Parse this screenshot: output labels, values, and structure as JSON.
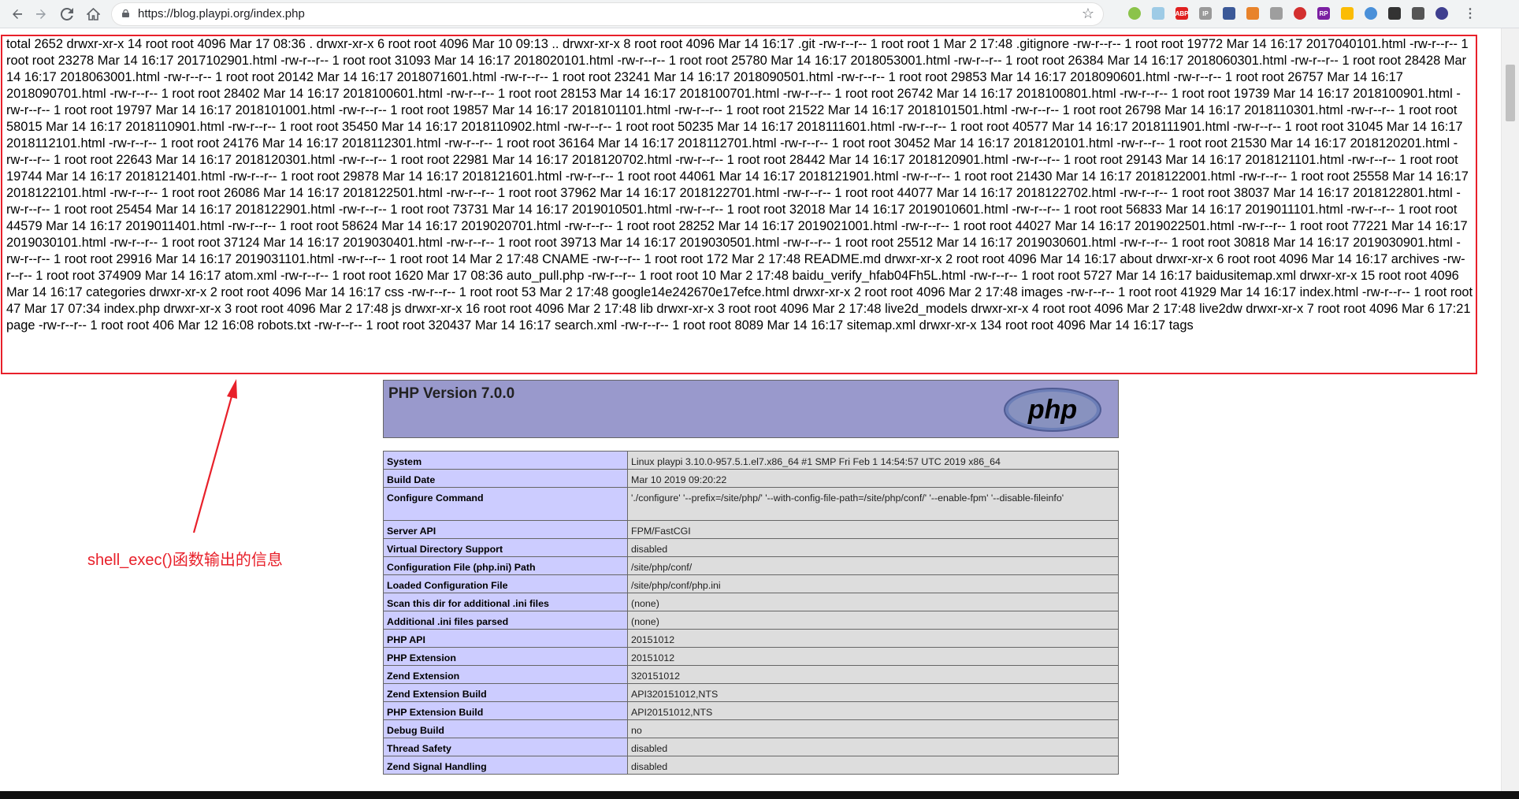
{
  "browser": {
    "url": "https://blog.playpi.org/index.php",
    "icons": [
      "back-icon",
      "forward-icon",
      "reload-icon",
      "home-icon",
      "lock-icon",
      "bookmark-star-icon"
    ],
    "extensions": [
      {
        "name": "green-dot-extension-icon",
        "color": "#8bc34a",
        "label": ""
      },
      {
        "name": "cloud-extension-icon",
        "color": "#9ecbe6",
        "label": ""
      },
      {
        "name": "adblock-plus-extension-icon",
        "color": "#e02020",
        "label": "ABP"
      },
      {
        "name": "ip-extension-icon",
        "color": "#999999",
        "label": "IP"
      },
      {
        "name": "square-extension-icon",
        "color": "#3b5998",
        "label": ""
      },
      {
        "name": "fox-extension-icon",
        "color": "#e8832b",
        "label": ""
      },
      {
        "name": "parachute-extension-icon",
        "color": "#9e9e9e",
        "label": ""
      },
      {
        "name": "red-circle-extension-icon",
        "color": "#d32f2f",
        "label": ""
      },
      {
        "name": "rp-extension-icon",
        "color": "#7b1fa2",
        "label": "RP"
      },
      {
        "name": "chrome-extension-icon",
        "color": "#fbbc05",
        "label": ""
      },
      {
        "name": "blue-circle-extension-icon",
        "color": "#4a90d9",
        "label": ""
      },
      {
        "name": "dark-square-extension-icon",
        "color": "#333333",
        "label": ""
      },
      {
        "name": "gear-extension-icon",
        "color": "#555555",
        "label": ""
      },
      {
        "name": "purple-dot-extension-icon",
        "color": "#3f3f8f",
        "label": ""
      },
      {
        "name": "menu-icon",
        "color": "#5f6368",
        "label": ""
      }
    ]
  },
  "shell_output": "total 2652 drwxr-xr-x 14 root root 4096 Mar 17 08:36 . drwxr-xr-x 6 root root 4096 Mar 10 09:13 .. drwxr-xr-x 8 root root 4096 Mar 14 16:17 .git -rw-r--r-- 1 root root 1 Mar 2 17:48 .gitignore -rw-r--r-- 1 root root 19772 Mar 14 16:17 2017040101.html -rw-r--r-- 1 root root 23278 Mar 14 16:17 2017102901.html -rw-r--r-- 1 root root 31093 Mar 14 16:17 2018020101.html -rw-r--r-- 1 root root 25780 Mar 14 16:17 2018053001.html -rw-r--r-- 1 root root 26384 Mar 14 16:17 2018060301.html -rw-r--r-- 1 root root 28428 Mar 14 16:17 2018063001.html -rw-r--r-- 1 root root 20142 Mar 14 16:17 2018071601.html -rw-r--r-- 1 root root 23241 Mar 14 16:17 2018090501.html -rw-r--r-- 1 root root 29853 Mar 14 16:17 2018090601.html -rw-r--r-- 1 root root 26757 Mar 14 16:17 2018090701.html -rw-r--r-- 1 root root 28402 Mar 14 16:17 2018100601.html -rw-r--r-- 1 root root 28153 Mar 14 16:17 2018100701.html -rw-r--r-- 1 root root 26742 Mar 14 16:17 2018100801.html -rw-r--r-- 1 root root 19739 Mar 14 16:17 2018100901.html -rw-r--r-- 1 root root 19797 Mar 14 16:17 2018101001.html -rw-r--r-- 1 root root 19857 Mar 14 16:17 2018101101.html -rw-r--r-- 1 root root 21522 Mar 14 16:17 2018101501.html -rw-r--r-- 1 root root 26798 Mar 14 16:17 2018110301.html -rw-r--r-- 1 root root 58015 Mar 14 16:17 2018110901.html -rw-r--r-- 1 root root 35450 Mar 14 16:17 2018110902.html -rw-r--r-- 1 root root 50235 Mar 14 16:17 2018111601.html -rw-r--r-- 1 root root 40577 Mar 14 16:17 2018111901.html -rw-r--r-- 1 root root 31045 Mar 14 16:17 2018112101.html -rw-r--r-- 1 root root 24176 Mar 14 16:17 2018112301.html -rw-r--r-- 1 root root 36164 Mar 14 16:17 2018112701.html -rw-r--r-- 1 root root 30452 Mar 14 16:17 2018120101.html -rw-r--r-- 1 root root 21530 Mar 14 16:17 2018120201.html -rw-r--r-- 1 root root 22643 Mar 14 16:17 2018120301.html -rw-r--r-- 1 root root 22981 Mar 14 16:17 2018120702.html -rw-r--r-- 1 root root 28442 Mar 14 16:17 2018120901.html -rw-r--r-- 1 root root 29143 Mar 14 16:17 2018121101.html -rw-r--r-- 1 root root 19744 Mar 14 16:17 2018121401.html -rw-r--r-- 1 root root 29878 Mar 14 16:17 2018121601.html -rw-r--r-- 1 root root 44061 Mar 14 16:17 2018121901.html -rw-r--r-- 1 root root 21430 Mar 14 16:17 2018122001.html -rw-r--r-- 1 root root 25558 Mar 14 16:17 2018122101.html -rw-r--r-- 1 root root 26086 Mar 14 16:17 2018122501.html -rw-r--r-- 1 root root 37962 Mar 14 16:17 2018122701.html -rw-r--r-- 1 root root 44077 Mar 14 16:17 2018122702.html -rw-r--r-- 1 root root 38037 Mar 14 16:17 2018122801.html -rw-r--r-- 1 root root 25454 Mar 14 16:17 2018122901.html -rw-r--r-- 1 root root 73731 Mar 14 16:17 2019010501.html -rw-r--r-- 1 root root 32018 Mar 14 16:17 2019010601.html -rw-r--r-- 1 root root 56833 Mar 14 16:17 2019011101.html -rw-r--r-- 1 root root 44579 Mar 14 16:17 2019011401.html -rw-r--r-- 1 root root 58624 Mar 14 16:17 2019020701.html -rw-r--r-- 1 root root 28252 Mar 14 16:17 2019021001.html -rw-r--r-- 1 root root 44027 Mar 14 16:17 2019022501.html -rw-r--r-- 1 root root 77221 Mar 14 16:17 2019030101.html -rw-r--r-- 1 root root 37124 Mar 14 16:17 2019030401.html -rw-r--r-- 1 root root 39713 Mar 14 16:17 2019030501.html -rw-r--r-- 1 root root 25512 Mar 14 16:17 2019030601.html -rw-r--r-- 1 root root 30818 Mar 14 16:17 2019030901.html -rw-r--r-- 1 root root 29916 Mar 14 16:17 2019031101.html -rw-r--r-- 1 root root 14 Mar 2 17:48 CNAME -rw-r--r-- 1 root root 172 Mar 2 17:48 README.md drwxr-xr-x 2 root root 4096 Mar 14 16:17 about drwxr-xr-x 6 root root 4096 Mar 14 16:17 archives -rw-r--r-- 1 root root 374909 Mar 14 16:17 atom.xml -rw-r--r-- 1 root root 1620 Mar 17 08:36 auto_pull.php -rw-r--r-- 1 root root 10 Mar 2 17:48 baidu_verify_hfab04Fh5L.html -rw-r--r-- 1 root root 5727 Mar 14 16:17 baidusitemap.xml drwxr-xr-x 15 root root 4096 Mar 14 16:17 categories drwxr-xr-x 2 root root 4096 Mar 14 16:17 css -rw-r--r-- 1 root root 53 Mar 2 17:48 google14e242670e17efce.html drwxr-xr-x 2 root root 4096 Mar 2 17:48 images -rw-r--r-- 1 root root 41929 Mar 14 16:17 index.html -rw-r--r-- 1 root root 47 Mar 17 07:34 index.php drwxr-xr-x 3 root root 4096 Mar 2 17:48 js drwxr-xr-x 16 root root 4096 Mar 2 17:48 lib drwxr-xr-x 3 root root 4096 Mar 2 17:48 live2d_models drwxr-xr-x 4 root root 4096 Mar 2 17:48 live2dw drwxr-xr-x 7 root root 4096 Mar 6 17:21 page -rw-r--r-- 1 root root 406 Mar 12 16:08 robots.txt -rw-r--r-- 1 root root 320437 Mar 14 16:17 search.xml -rw-r--r-- 1 root root 8089 Mar 14 16:17 sitemap.xml drwxr-xr-x 134 root root 4096 Mar 14 16:17 tags",
  "annotation": {
    "text": "shell_exec()函数输出的信息",
    "color": "#e8202a"
  },
  "phpinfo": {
    "title": "PHP Version 7.0.0",
    "logo_text": "php",
    "header_color": "#9999cc",
    "label_color": "#ccccff",
    "value_color": "#dddddd",
    "rows": [
      {
        "label": "System",
        "value": "Linux playpi 3.10.0-957.5.1.el7.x86_64 #1 SMP Fri Feb 1 14:54:57 UTC 2019 x86_64"
      },
      {
        "label": "Build Date",
        "value": "Mar 10 2019 09:20:22"
      },
      {
        "label": "Configure Command",
        "value": "'./configure' '--prefix=/site/php/' '--with-config-file-path=/site/php/conf/' '--enable-fpm' '--disable-fileinfo'"
      },
      {
        "label": "Server API",
        "value": "FPM/FastCGI"
      },
      {
        "label": "Virtual Directory Support",
        "value": "disabled"
      },
      {
        "label": "Configuration File (php.ini) Path",
        "value": "/site/php/conf/"
      },
      {
        "label": "Loaded Configuration File",
        "value": "/site/php/conf/php.ini"
      },
      {
        "label": "Scan this dir for additional .ini files",
        "value": "(none)"
      },
      {
        "label": "Additional .ini files parsed",
        "value": "(none)"
      },
      {
        "label": "PHP API",
        "value": "20151012"
      },
      {
        "label": "PHP Extension",
        "value": "20151012"
      },
      {
        "label": "Zend Extension",
        "value": "320151012"
      },
      {
        "label": "Zend Extension Build",
        "value": "API320151012,NTS"
      },
      {
        "label": "PHP Extension Build",
        "value": "API20151012,NTS"
      },
      {
        "label": "Debug Build",
        "value": "no"
      },
      {
        "label": "Thread Safety",
        "value": "disabled"
      },
      {
        "label": "Zend Signal Handling",
        "value": "disabled"
      }
    ]
  }
}
